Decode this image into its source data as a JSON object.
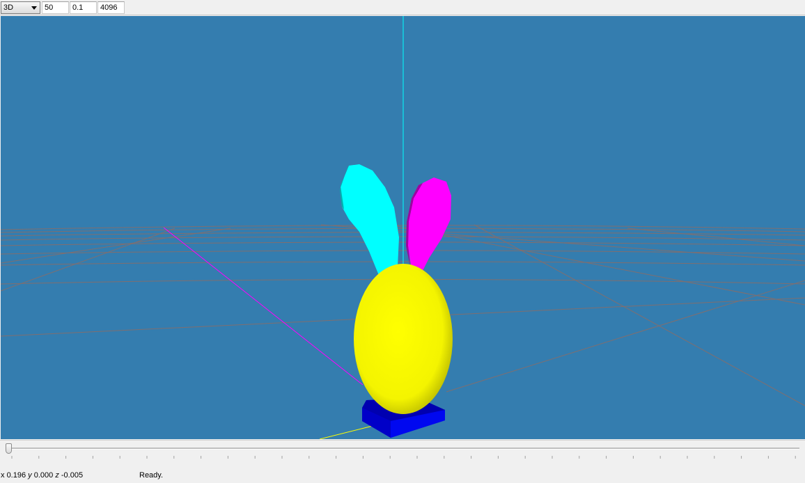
{
  "toolbar": {
    "mode": "3D",
    "field1": "50",
    "field2": "0.1",
    "field3": "4096"
  },
  "status": {
    "x_label": "x",
    "x_value": "0.196",
    "y_label": "y",
    "y_value": "0.000",
    "z_label": "z",
    "z_value": "-0.005",
    "message": "Ready."
  },
  "timeline": {
    "position": 0
  },
  "colors": {
    "viewport_bg": "#347daf",
    "egg": "#ffff00",
    "left_ear": "#00ffff",
    "right_ear": "#ff00ff",
    "base": "#0000e0"
  },
  "icons": {
    "dropdown": "chevron-down-icon"
  }
}
